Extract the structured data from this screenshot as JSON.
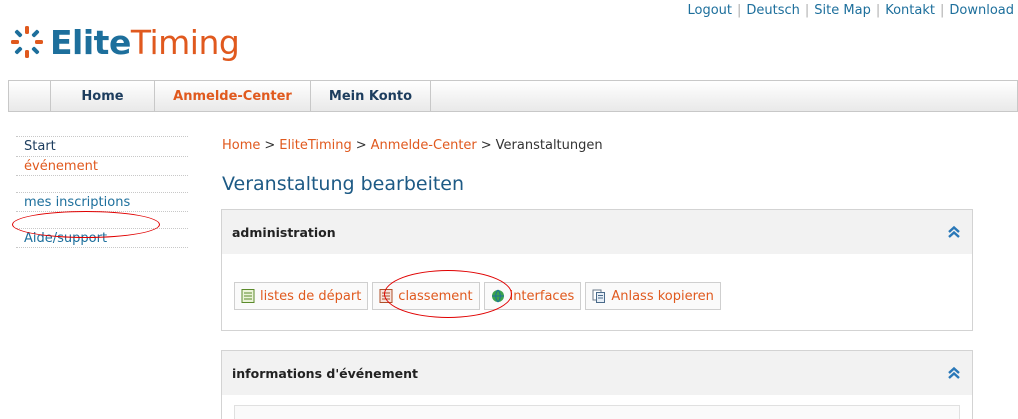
{
  "brand": {
    "word1": "Elite",
    "word2": "Timing"
  },
  "top_links": [
    "Logout",
    "Deutsch",
    "Site Map",
    "Kontakt",
    "Download"
  ],
  "nav": {
    "tabs": [
      "Home",
      "Anmelde-Center",
      "Mein Konto"
    ],
    "active": "Anmelde-Center"
  },
  "sidebar": {
    "items": [
      "Start",
      "événement",
      "mes inscriptions",
      "Aide/support"
    ]
  },
  "breadcrumb": [
    "Home",
    "EliteTiming",
    "Anmelde-Center",
    "Veranstaltungen"
  ],
  "page_title": "Veranstaltung bearbeiten",
  "panels": [
    {
      "title": "administration",
      "buttons": [
        {
          "label": "listes de départ",
          "icon": "list-icon"
        },
        {
          "label": "classement",
          "icon": "list-icon"
        },
        {
          "label": "interfaces",
          "icon": "globe-icon"
        },
        {
          "label": "Anlass kopieren",
          "icon": "copy-icon"
        }
      ]
    },
    {
      "title": "informations d'événement"
    }
  ],
  "colors": {
    "brand_blue": "#1d6f9c",
    "brand_orange": "#e0591e",
    "annotation_red": "#e00000"
  }
}
